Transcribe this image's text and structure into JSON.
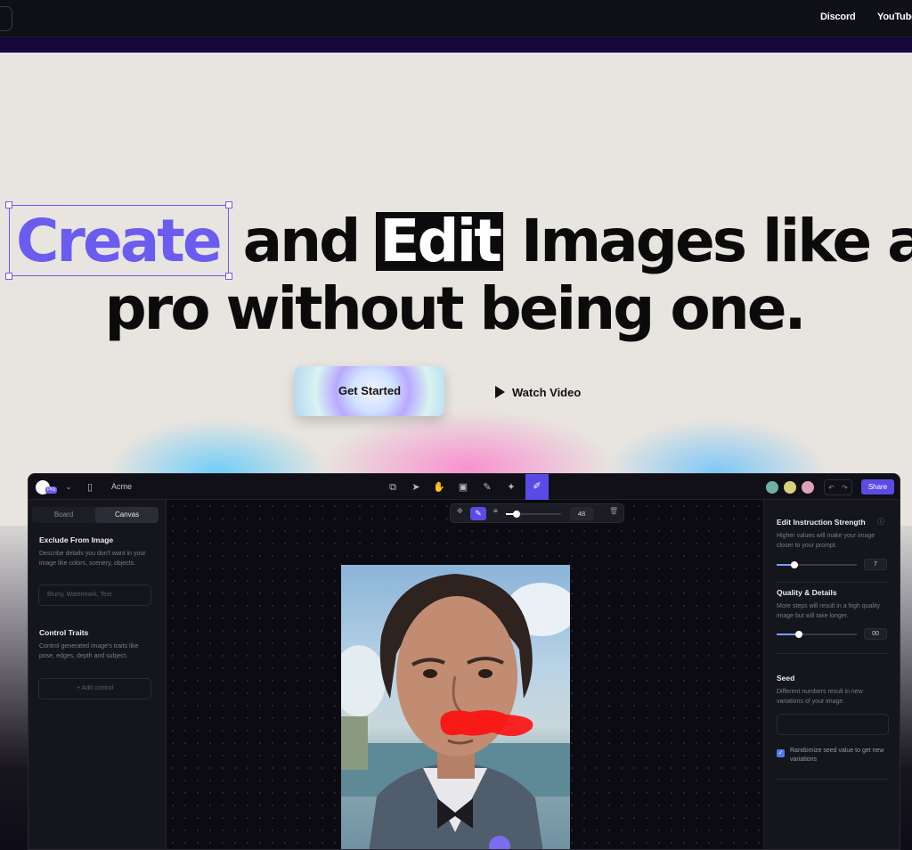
{
  "topnav": {
    "links": [
      "Discord",
      "YouTube"
    ]
  },
  "hero": {
    "line1_word1": "Create",
    "line1_mid": " and ",
    "line1_word2": "Edit",
    "line1_rest": " Images like a",
    "line2": "pro without being one.",
    "cta_primary": "Get Started",
    "cta_secondary": "Watch Video"
  },
  "app": {
    "badge": "Pro",
    "project_name": "Acme",
    "share_label": "Share",
    "tabs": [
      "Board",
      "Canvas"
    ],
    "active_tab": "Canvas",
    "left_panel": {
      "exclude_title": "Exclude From Image",
      "exclude_desc": "Describe details you don't want in your image like colors, scenery, objects.",
      "exclude_placeholder": "Blurry, Watermark, Text",
      "control_title": "Control Traits",
      "control_desc": "Control generated image's traits like pose, edges, depth and subject.",
      "add_control": "+ Add control"
    },
    "brush": {
      "size": "48",
      "size_level": 0.2
    },
    "right_panel": {
      "strength_title": "Edit Instruction Strength",
      "strength_desc": "Higher values will make your image closer to your prompt.",
      "strength_value": "7",
      "strength_level": 0.22,
      "quality_title": "Quality & Details",
      "quality_desc": "More steps will result in a high quality image but will take longer.",
      "quality_value": "00",
      "quality_level": 0.28,
      "seed_title": "Seed",
      "seed_desc": "Different numbers result in new variations of your image.",
      "randomize_label": "Randomize seed value to get new variations"
    },
    "colors": {
      "accent": "#5b4be6",
      "mask": "#ff0a0a"
    }
  }
}
